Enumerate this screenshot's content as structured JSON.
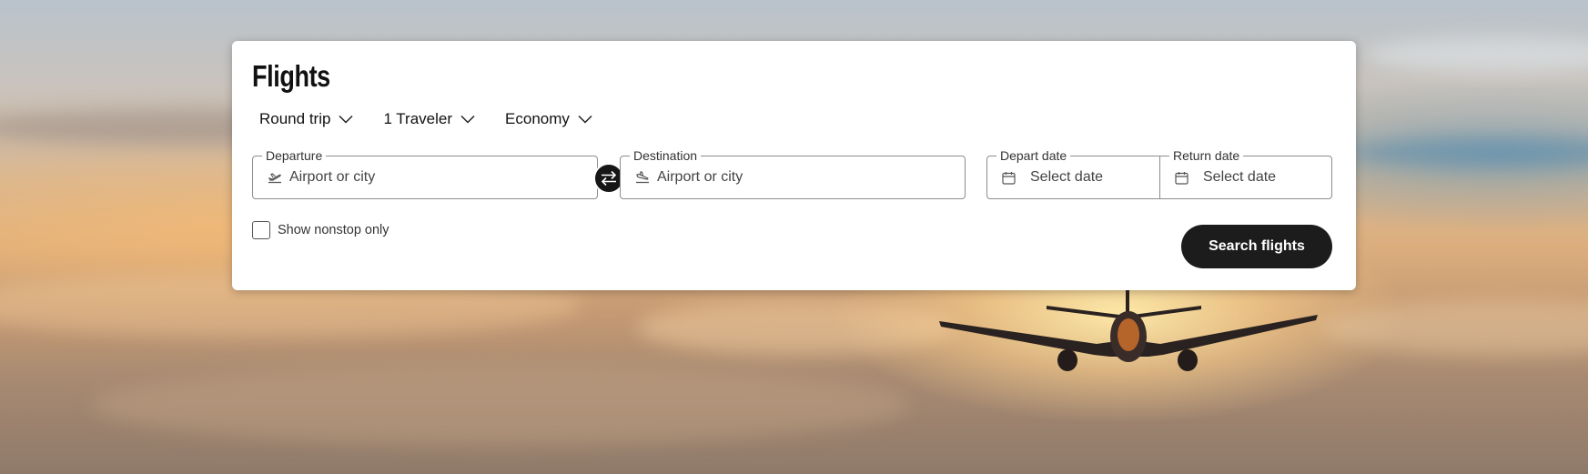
{
  "search": {
    "title": "Flights",
    "trip_type": "Round trip",
    "travelers": "1 Traveler",
    "cabin_class": "Economy",
    "departure": {
      "label": "Departure",
      "placeholder": "Airport or city"
    },
    "destination": {
      "label": "Destination",
      "placeholder": "Airport or city"
    },
    "depart_date": {
      "label": "Depart date",
      "placeholder": "Select date"
    },
    "return_date": {
      "label": "Return date",
      "placeholder": "Select date"
    },
    "nonstop_label": "Show nonstop only",
    "nonstop_checked": false,
    "submit_label": "Search flights"
  },
  "icons": [
    "chevron-down-icon",
    "plane-takeoff-icon",
    "plane-landing-icon",
    "swap-icon",
    "calendar-icon"
  ],
  "colors": {
    "button": "#1c1c1c",
    "card": "#ffffff",
    "border": "#8c8c8c"
  }
}
